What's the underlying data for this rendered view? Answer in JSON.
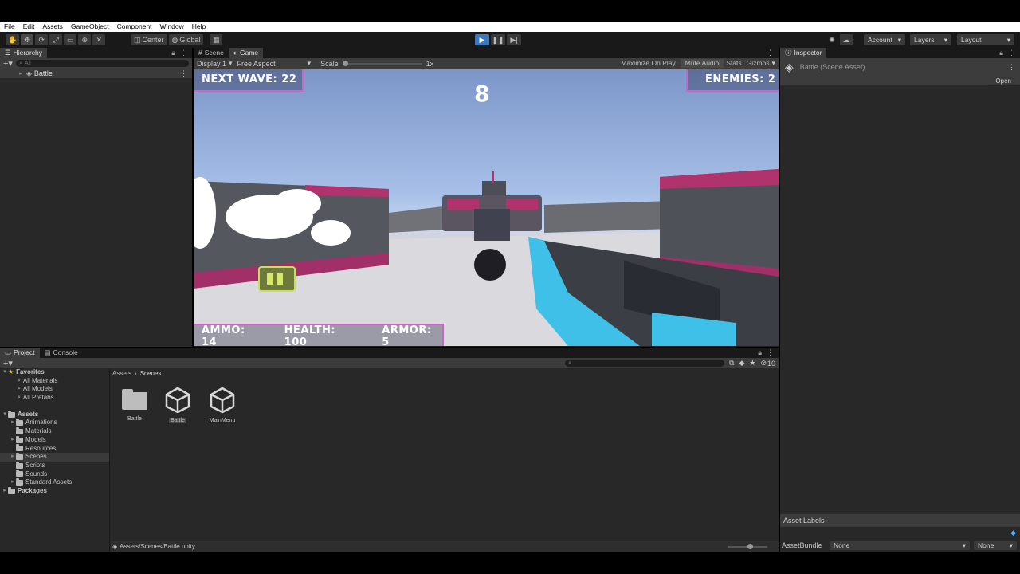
{
  "menubar": [
    "File",
    "Edit",
    "Assets",
    "GameObject",
    "Component",
    "Window",
    "Help"
  ],
  "toolbar": {
    "pivot_label": "Center",
    "space_label": "Global",
    "account_label": "Account",
    "layers_label": "Layers",
    "layout_label": "Layout"
  },
  "hierarchy": {
    "tab_label": "Hierarchy",
    "search_placeholder": "All",
    "scene_name": "Battle"
  },
  "game_view": {
    "tabs": [
      "Scene",
      "Game"
    ],
    "display": "Display 1",
    "aspect": "Free Aspect",
    "scale_label": "Scale",
    "scale_value": "1x",
    "scale_fraction": 0.0,
    "options": [
      "Maximize On Play",
      "Mute Audio",
      "Stats",
      "Gizmos"
    ]
  },
  "hud": {
    "next_wave": "NEXT WAVE: 22",
    "countdown": "8",
    "enemies": "ENEMIES: 2",
    "ammo": "AMMO: 14",
    "health": "HEALTH: 100",
    "armor": "ARMOR: 5"
  },
  "inspector": {
    "tab_label": "Inspector",
    "asset_title": "Battle (Scene Asset)",
    "open_button": "Open",
    "asset_labels": "Asset Labels",
    "asset_bundle_label": "AssetBundle",
    "asset_bundle_value": "None",
    "asset_variant_value": "None"
  },
  "project": {
    "tabs": [
      "Project",
      "Console"
    ],
    "favorites_label": "Favorites",
    "favorites": [
      "All Materials",
      "All Models",
      "All Prefabs"
    ],
    "assets_label": "Assets",
    "asset_folders": [
      "Animations",
      "Materials",
      "Models",
      "Resources",
      "Scenes",
      "Scripts",
      "Sounds",
      "Standard Assets"
    ],
    "packages_label": "Packages",
    "breadcrumb": [
      "Assets",
      "Scenes"
    ],
    "items": [
      {
        "name": "Battle",
        "kind": "folder-icon"
      },
      {
        "name": "Battle",
        "kind": "unity-scene-icon"
      },
      {
        "name": "MainMenu",
        "kind": "unity-scene-icon"
      }
    ],
    "hidden_count": "10",
    "status_path": "Assets/Scenes/Battle.unity"
  },
  "colors": {
    "accent_pink": "#d062c9",
    "weapon_cyan": "#3fc0e8",
    "play_blue": "#3a79bb"
  }
}
